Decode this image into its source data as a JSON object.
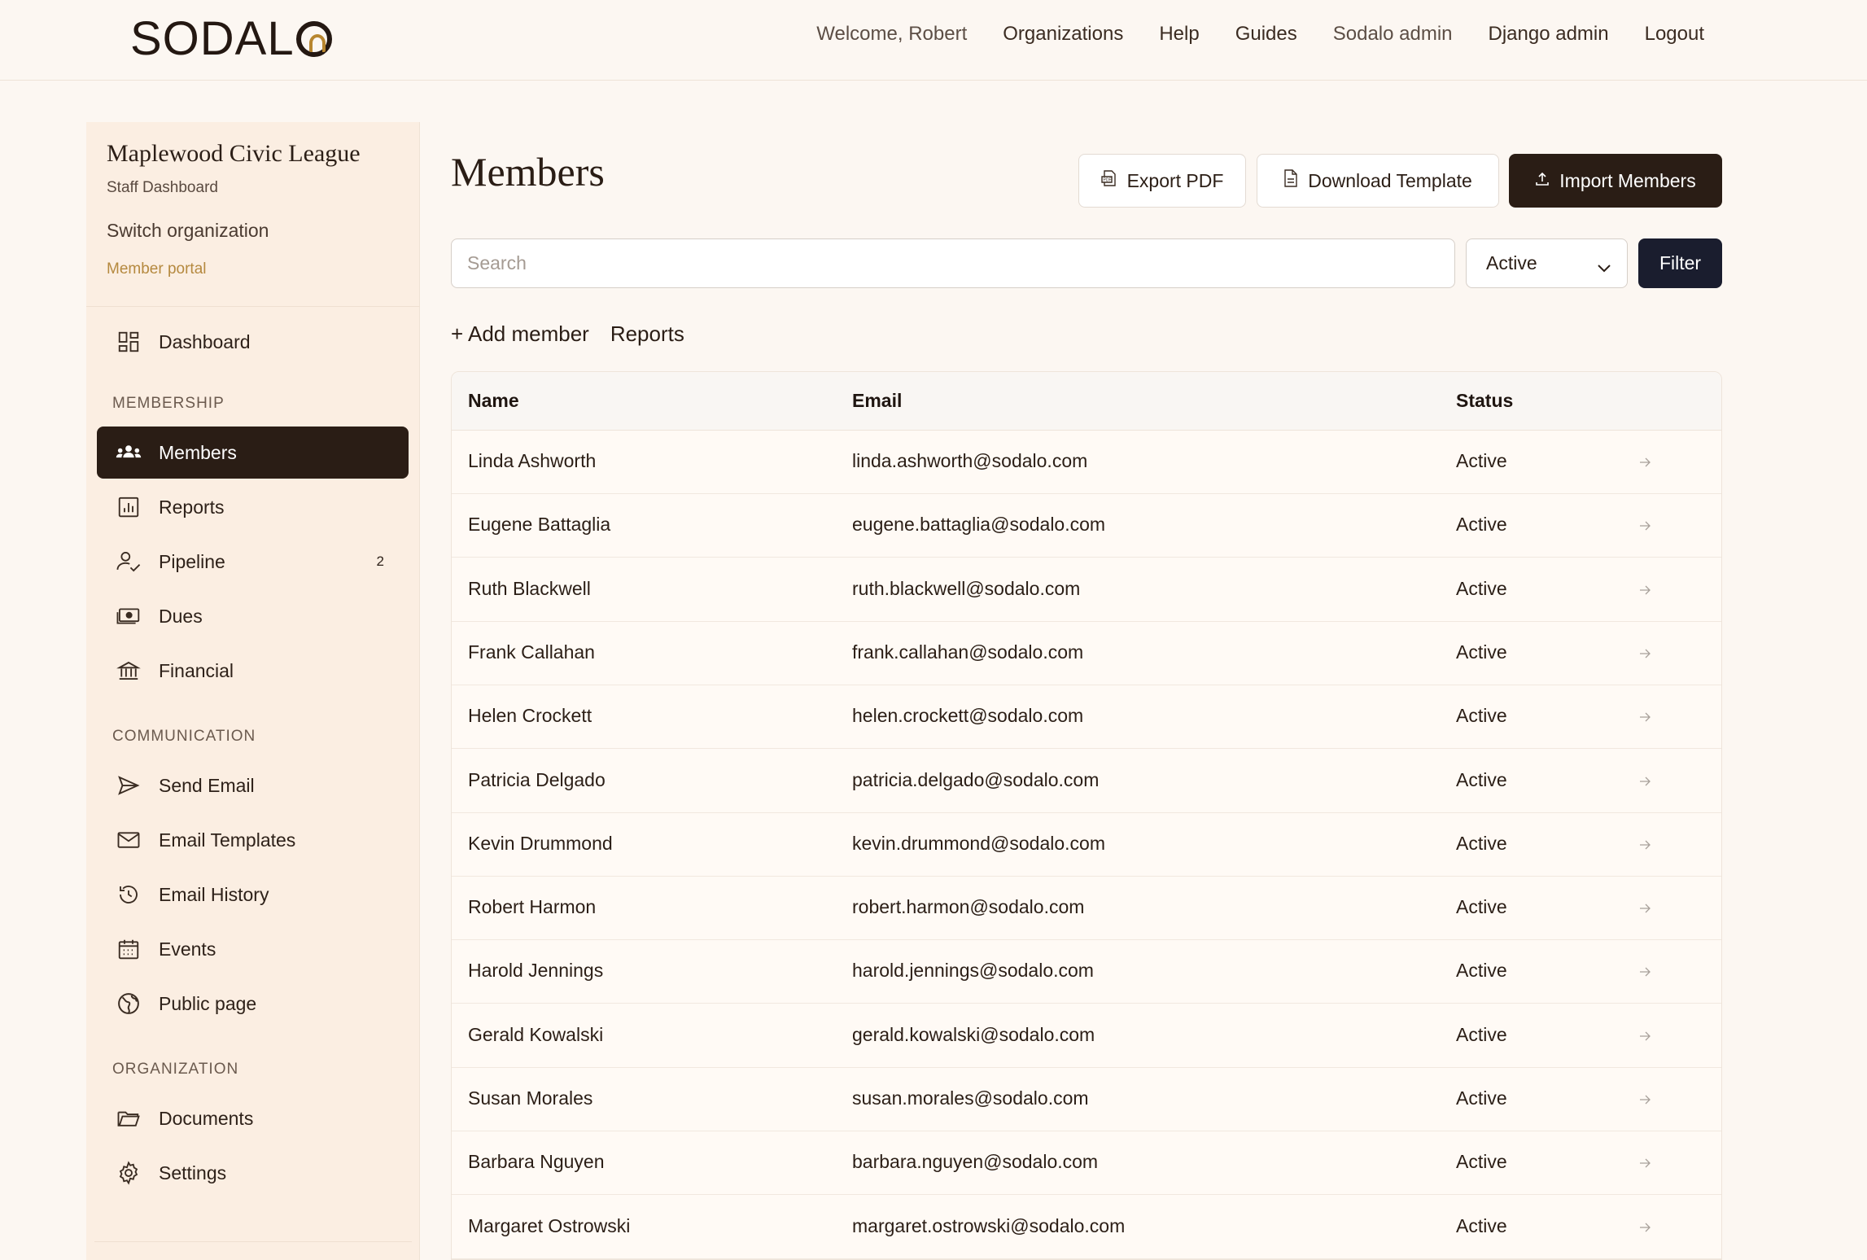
{
  "brand": {
    "logo_text": "SODAL"
  },
  "topnav": {
    "welcome": "Welcome, Robert",
    "items": [
      "Organizations",
      "Help",
      "Guides",
      "Sodalo admin",
      "Django admin",
      "Logout"
    ]
  },
  "sidebar": {
    "org_name": "Maplewood Civic League",
    "org_subtitle": "Staff Dashboard",
    "switch_org": "Switch organization",
    "member_portal": "Member portal",
    "dashboard": {
      "label": "Dashboard",
      "icon": "dashboard-grid-icon"
    },
    "sections": {
      "membership": "MEMBERSHIP",
      "communication": "COMMUNICATION",
      "organization": "ORGANIZATION"
    },
    "items": [
      {
        "label": "Members",
        "icon": "members-group-icon",
        "active": true
      },
      {
        "label": "Reports",
        "icon": "bar-chart-icon"
      },
      {
        "label": "Pipeline",
        "icon": "user-check-icon",
        "badge": "2"
      },
      {
        "label": "Dues",
        "icon": "banknote-icon"
      },
      {
        "label": "Financial",
        "icon": "bank-building-icon"
      },
      {
        "label": "Send Email",
        "icon": "paper-plane-icon"
      },
      {
        "label": "Email Templates",
        "icon": "envelope-icon"
      },
      {
        "label": "Email History",
        "icon": "history-clock-icon"
      },
      {
        "label": "Events",
        "icon": "calendar-icon"
      },
      {
        "label": "Public page",
        "icon": "globe-icon"
      },
      {
        "label": "Documents",
        "icon": "folder-icon"
      },
      {
        "label": "Settings",
        "icon": "gear-icon"
      }
    ]
  },
  "main": {
    "title": "Members",
    "actions": {
      "export_pdf": "Export PDF",
      "download_template": "Download Template",
      "import_members": "Import Members"
    },
    "search_placeholder": "Search",
    "status_filter_value": "Active",
    "filter_button": "Filter",
    "add_member": "+ Add member",
    "reports_link": "Reports"
  },
  "table": {
    "headers": {
      "name": "Name",
      "email": "Email",
      "status": "Status"
    },
    "rows": [
      {
        "name": "Linda Ashworth",
        "email": "linda.ashworth@sodalo.com",
        "status": "Active"
      },
      {
        "name": "Eugene Battaglia",
        "email": "eugene.battaglia@sodalo.com",
        "status": "Active"
      },
      {
        "name": "Ruth Blackwell",
        "email": "ruth.blackwell@sodalo.com",
        "status": "Active"
      },
      {
        "name": "Frank Callahan",
        "email": "frank.callahan@sodalo.com",
        "status": "Active"
      },
      {
        "name": "Helen Crockett",
        "email": "helen.crockett@sodalo.com",
        "status": "Active"
      },
      {
        "name": "Patricia Delgado",
        "email": "patricia.delgado@sodalo.com",
        "status": "Active"
      },
      {
        "name": "Kevin Drummond",
        "email": "kevin.drummond@sodalo.com",
        "status": "Active"
      },
      {
        "name": "Robert Harmon",
        "email": "robert.harmon@sodalo.com",
        "status": "Active"
      },
      {
        "name": "Harold Jennings",
        "email": "harold.jennings@sodalo.com",
        "status": "Active"
      },
      {
        "name": "Gerald Kowalski",
        "email": "gerald.kowalski@sodalo.com",
        "status": "Active"
      },
      {
        "name": "Susan Morales",
        "email": "susan.morales@sodalo.com",
        "status": "Active"
      },
      {
        "name": "Barbara Nguyen",
        "email": "barbara.nguyen@sodalo.com",
        "status": "Active"
      },
      {
        "name": "Margaret Ostrowski",
        "email": "margaret.ostrowski@sodalo.com",
        "status": "Active"
      }
    ]
  },
  "colors": {
    "background": "#fcf7f2",
    "sidebar": "#fbeee2",
    "dark_brown": "#2a1d15",
    "accent_gold": "#b5893f",
    "filter_navy": "#1a1d2e"
  }
}
